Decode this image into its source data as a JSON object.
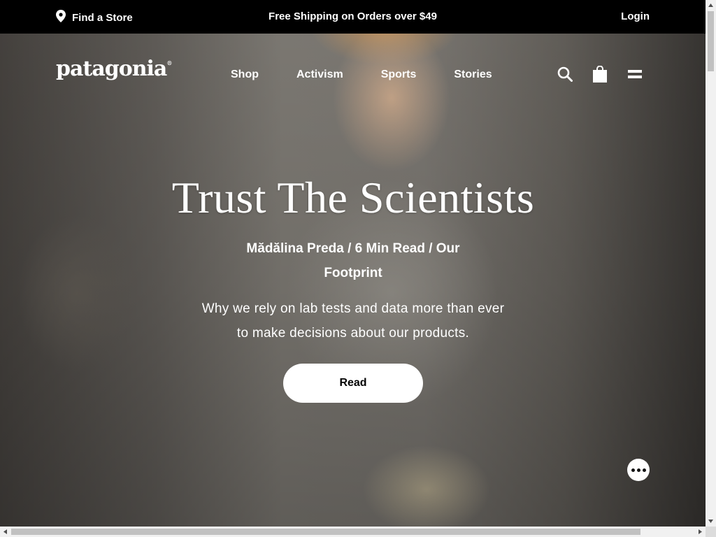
{
  "utility_bar": {
    "find_store_label": "Find a Store",
    "find_store_icon": "map-pin-icon",
    "promo_text": "Free Shipping on Orders over $49",
    "login_label": "Login"
  },
  "header": {
    "logo_text": "patagonia",
    "logo_mark": "®",
    "nav": [
      {
        "label": "Shop"
      },
      {
        "label": "Activism"
      },
      {
        "label": "Sports"
      },
      {
        "label": "Stories"
      }
    ],
    "icons": [
      "search-icon",
      "shopping-bag-icon",
      "menu-icon"
    ]
  },
  "hero": {
    "title": "Trust The Scientists",
    "byline": "Mădălina Preda / 6 Min Read / Our Footprint",
    "dek": "Why we rely on lab tests and data more than ever to make decisions about our products.",
    "cta_label": "Read"
  },
  "chat": {
    "icon": "chat-ellipsis-icon"
  },
  "colors": {
    "utility_bg": "#000000",
    "text": "#ffffff",
    "button_bg": "#ffffff",
    "button_text": "#000000"
  }
}
